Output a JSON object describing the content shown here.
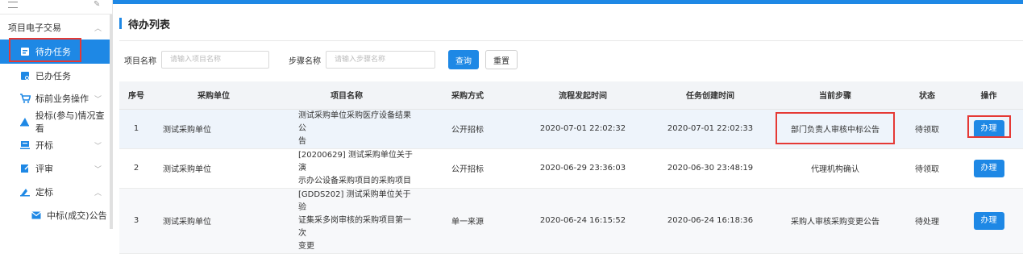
{
  "sidebar": {
    "items": [
      {
        "label": "项目电子交易",
        "icon": "none",
        "chevron": "^"
      },
      {
        "label": "待办任务",
        "icon": "task-icon",
        "active": true
      },
      {
        "label": "已办任务",
        "icon": "done-task-icon"
      },
      {
        "label": "标前业务操作",
        "icon": "cart-icon",
        "chevron": "v"
      },
      {
        "label": "投标(参与)情况查看",
        "icon": "bid-view-icon"
      },
      {
        "label": "开标",
        "icon": "open-bid-icon",
        "chevron": "v"
      },
      {
        "label": "评审",
        "icon": "review-icon",
        "chevron": "v"
      },
      {
        "label": "定标",
        "icon": "award-icon",
        "chevron": "^"
      },
      {
        "label": "中标(成交)公告",
        "icon": "mail-icon"
      }
    ]
  },
  "main": {
    "title": "待办列表",
    "filters": {
      "project_label": "项目名称",
      "project_placeholder": "请输入项目名称",
      "step_label": "步骤名称",
      "step_placeholder": "请输入步骤名称",
      "query_label": "查询",
      "reset_label": "重置"
    },
    "table": {
      "headers": [
        "序号",
        "采购单位",
        "项目名称",
        "采购方式",
        "流程发起时间",
        "任务创建时间",
        "当前步骤",
        "状态",
        "操作"
      ],
      "rows": [
        {
          "no": "1",
          "unit": "测试采购单位",
          "name_lines": [
            "测试采购单位采购医疗设备结果公",
            "告"
          ],
          "method": "公开招标",
          "start": "2020-07-01 22:02:32",
          "created": "2020-07-01 22:02:33",
          "step": "部门负责人审核中标公告",
          "status": "待领取",
          "op": "办理"
        },
        {
          "no": "2",
          "unit": "测试采购单位",
          "name_lines": [
            "[20200629] 测试采购单位关于演",
            "示办公设备采购项目的采购项目"
          ],
          "method": "公开招标",
          "start": "2020-06-29 23:36:03",
          "created": "2020-06-30 23:48:19",
          "step": "代理机构确认",
          "status": "待领取",
          "op": "办理"
        },
        {
          "no": "3",
          "unit": "测试采购单位",
          "name_lines": [
            "[GDDS202] 测试采购单位关于验",
            "证集采多岗审核的采购项目第一次",
            "变更"
          ],
          "method": "单一来源",
          "start": "2020-06-24 16:15:52",
          "created": "2020-06-24 16:18:36",
          "step": "采购人审核采购变更公告",
          "status": "待处理",
          "op": "办理"
        }
      ]
    }
  },
  "colors": {
    "accent": "#1e88e5",
    "highlight": "#e53935"
  }
}
